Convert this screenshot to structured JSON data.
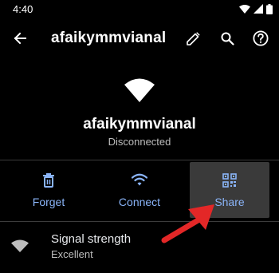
{
  "status_bar": {
    "time": "4:40"
  },
  "app_bar": {
    "title": "afaikymmvianal",
    "back_icon": "arrow-back-icon",
    "edit_icon": "pencil-icon",
    "search_icon": "search-icon",
    "help_icon": "help-icon"
  },
  "network": {
    "name": "afaikymmvianal",
    "status": "Disconnected"
  },
  "actions": [
    {
      "label": "Forget",
      "icon": "trash-icon"
    },
    {
      "label": "Connect",
      "icon": "wifi-icon"
    },
    {
      "label": "Share",
      "icon": "qr-code-icon"
    }
  ],
  "signal": {
    "title": "Signal strength",
    "value": "Excellent"
  },
  "colors": {
    "background": "#000000",
    "accent": "#8ab4f8",
    "highlight": "#3a3a3a",
    "annotation_arrow": "#e32727"
  }
}
